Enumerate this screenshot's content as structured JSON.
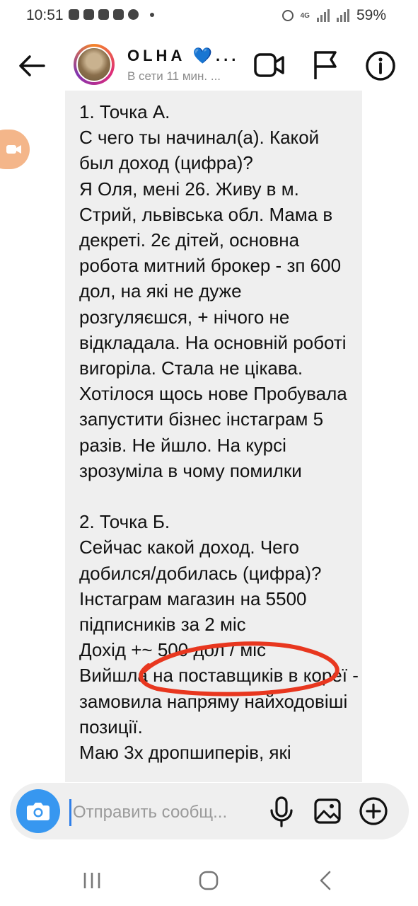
{
  "status_bar": {
    "time": "10:51",
    "network": "4G",
    "battery": "59%"
  },
  "header": {
    "name": "OLHA 💙...",
    "status": "В сети 11 мин. ..."
  },
  "message": {
    "text": "1. Точка А.\nС чего ты начинал(а). Какой был доход (цифра)?\nЯ Оля, мені 26. Живу в м. Стрий, львівська обл. Мама в декреті. 2є дітей, основна робота митний брокер - зп 600 дол, на які не дуже розгуляєшся, + нічого не відкладала. На основній роботі вигоріла. Стала не цікава. Хотілося щось нове Пробувала запустити бізнес інстаграм 5 разів. Не йшло. На курсі зрозуміла в чому помилки\n\n2. Точка Б.\nСейчас какой доход. Чего добился/добилась (цифра)?\nІнстаграм магазин на 5500 підписників за 2 міс\nДохід +~ 500 дол / міс\nВийшла на поставщиків в кореї - замовила напряму найходовіші позиції.\nМаю 3х дропшиперів, які"
  },
  "composer": {
    "placeholder": "Отправить сообщ..."
  },
  "colors": {
    "accent": "#3797f0",
    "annotation": "#e8371f",
    "bubble": "#efefef"
  },
  "icons": [
    "back-arrow-icon",
    "video-call-icon",
    "flag-icon",
    "info-icon",
    "camera-icon",
    "microphone-icon",
    "gallery-icon",
    "sticker-add-icon"
  ]
}
